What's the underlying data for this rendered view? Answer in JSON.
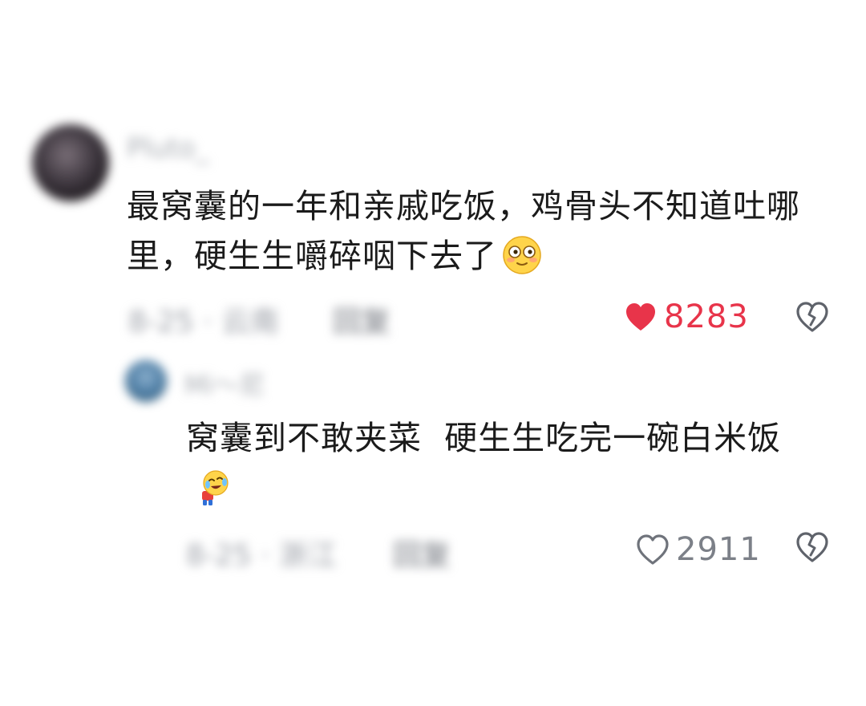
{
  "comment": {
    "username": "Pluto_",
    "text": "最窝囊的一年和亲戚吃饭，鸡骨头不知道吐哪里，硬生生嚼碎咽下去了",
    "emoji": "blushing-face-emoji",
    "meta_time": "8-25 · 云南",
    "reply_label": "回复",
    "like_count": "8283",
    "liked": true,
    "like_color": "#e8344a"
  },
  "reply": {
    "username": "Mi～尼",
    "text": "窝囊到不敢夹菜  硬生生吃完一碗白米饭",
    "emoji": "bowing-laughing-tears-emoji",
    "meta_time": "8-25 · 浙江",
    "reply_label": "回复",
    "like_count": "2911",
    "liked": false
  },
  "icons": {
    "like_filled": "heart-filled-icon",
    "like_outline": "heart-outline-icon",
    "dislike": "broken-heart-icon"
  }
}
